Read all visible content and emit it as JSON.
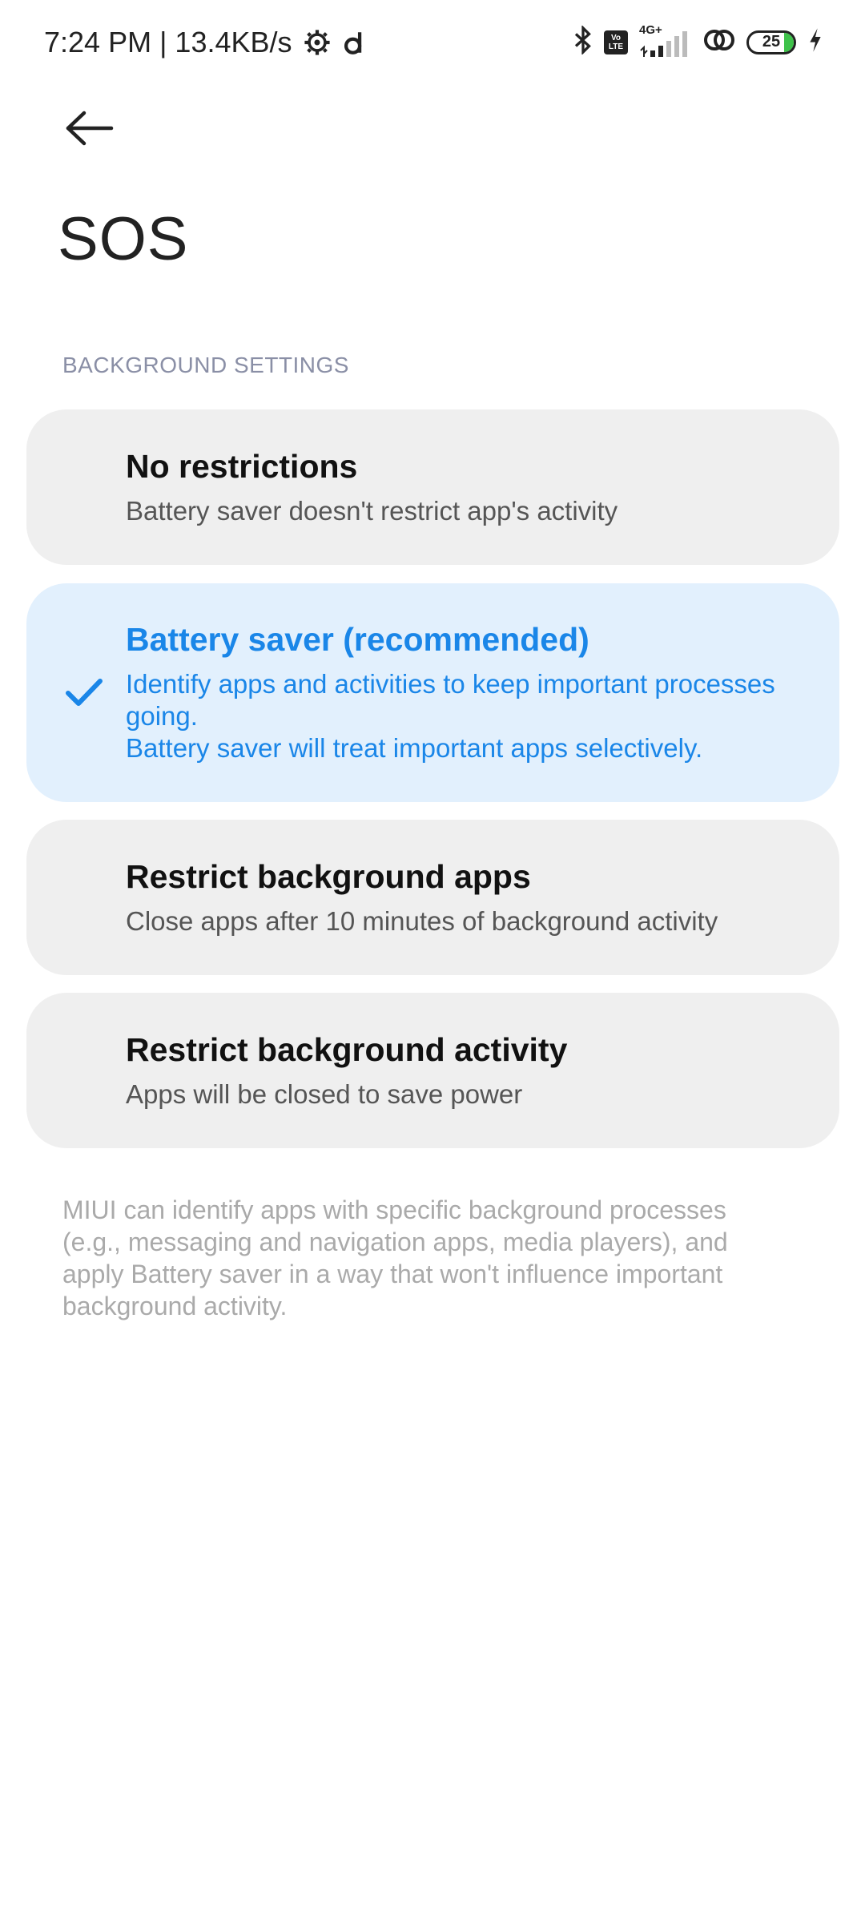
{
  "status_bar": {
    "time_speed": "7:24 PM | 13.4KB/s",
    "network": "4G+",
    "volte_top": "Vo",
    "volte_bottom": "LTE",
    "battery_level": "25"
  },
  "header": {
    "title": "SOS"
  },
  "section": {
    "label": "BACKGROUND SETTINGS"
  },
  "options": [
    {
      "title": "No restrictions",
      "desc": "Battery saver doesn't restrict app's activity",
      "selected": false
    },
    {
      "title": "Battery saver (recommended)",
      "desc1": "Identify apps and activities to keep important processes going.",
      "desc2": "Battery saver will treat important apps selectively.",
      "selected": true
    },
    {
      "title": "Restrict background apps",
      "desc": "Close apps after 10 minutes of background activity",
      "selected": false
    },
    {
      "title": "Restrict background activity",
      "desc": "Apps will be closed to save power",
      "selected": false
    }
  ],
  "footnote": "MIUI can identify apps with specific background processes (e.g., messaging and navigation apps, media players), and apply Battery saver in a way that won't influence important background activity.",
  "colors": {
    "accent": "#1a86e8",
    "selected_bg": "#e2f0fd",
    "card_bg": "#efefef",
    "section_header": "#8a8fa6"
  },
  "icons": {
    "back": "arrow-left-icon",
    "check": "checkmark-icon"
  }
}
